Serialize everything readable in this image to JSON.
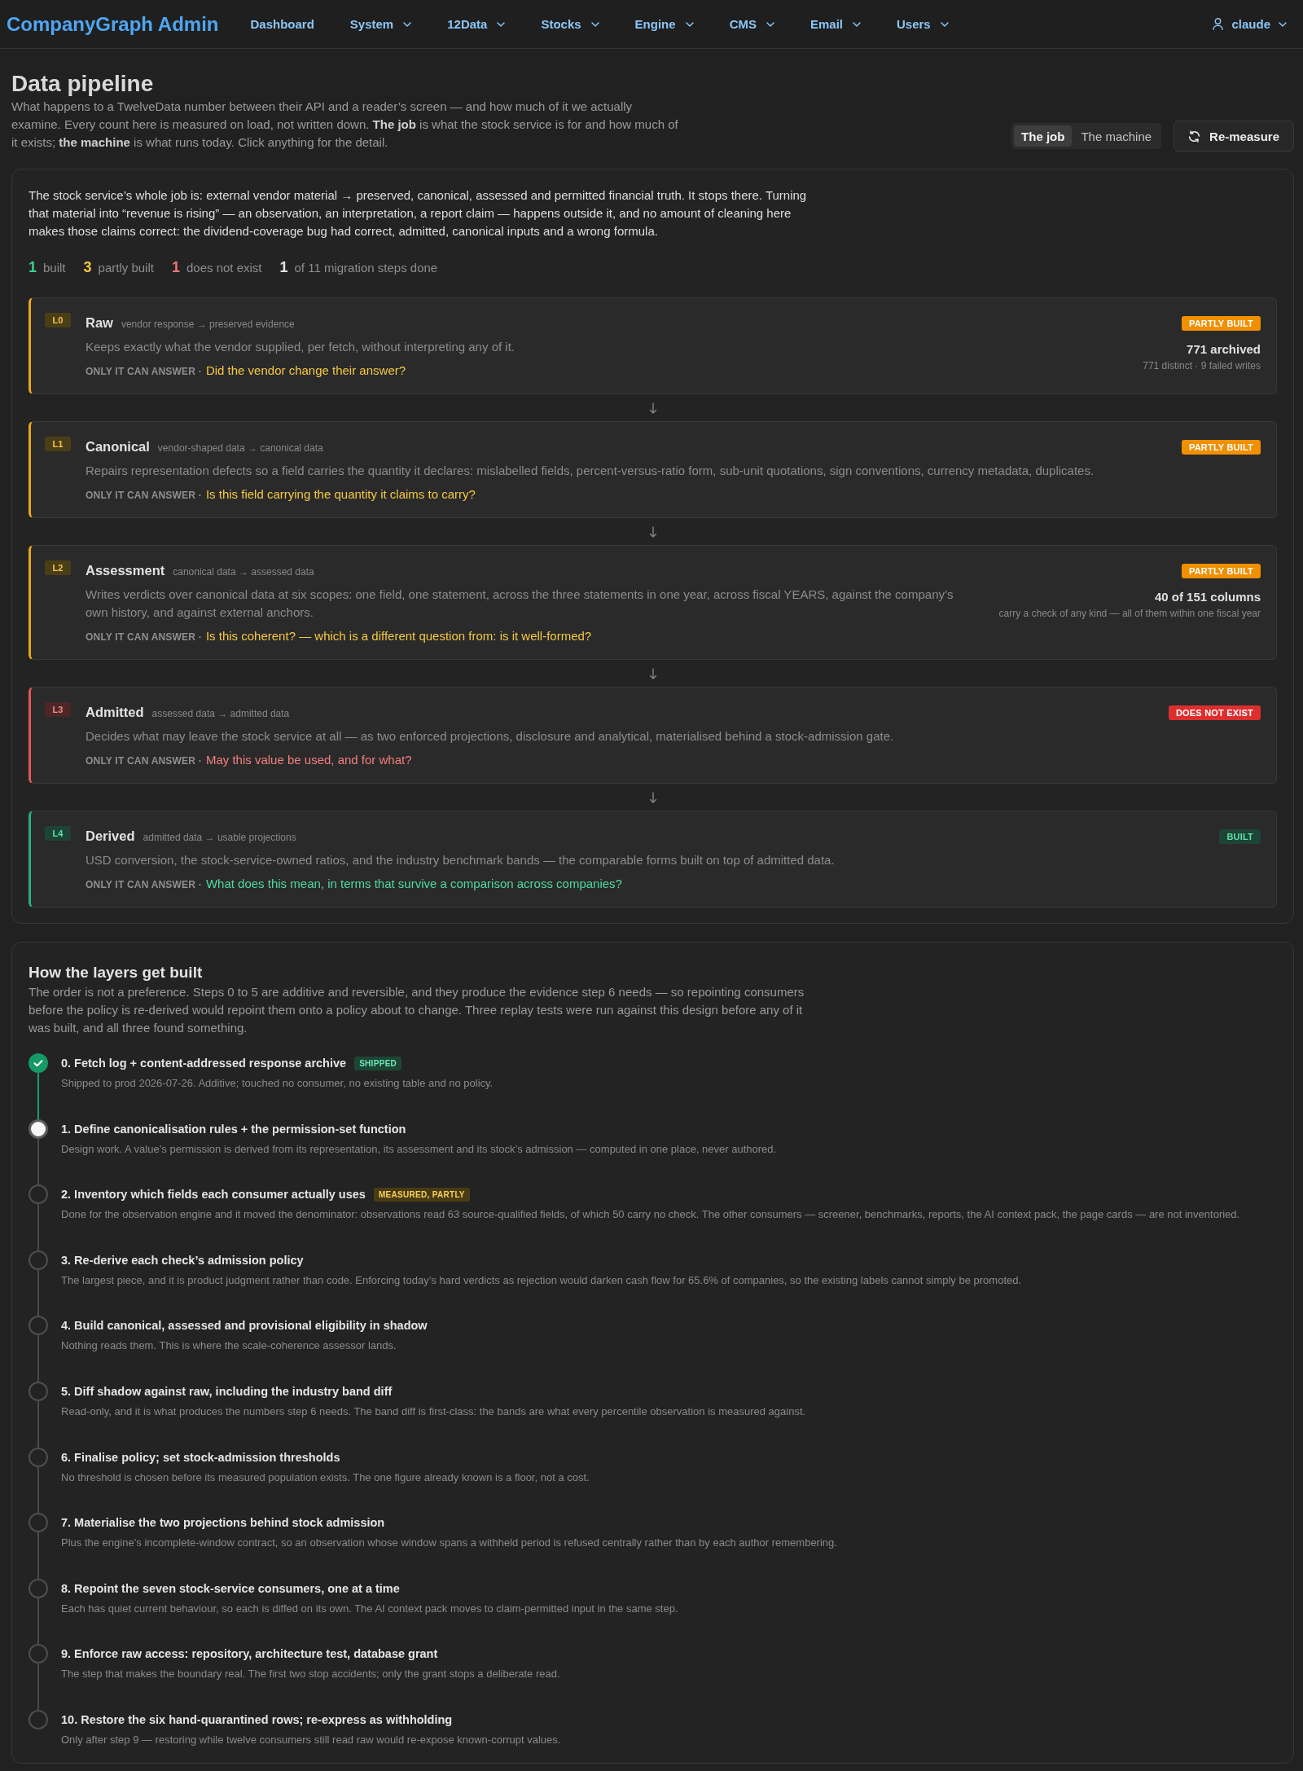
{
  "nav": {
    "brand": "CompanyGraph Admin",
    "items": [
      {
        "label": "Dashboard",
        "dropdown": false
      },
      {
        "label": "System",
        "dropdown": true
      },
      {
        "label": "12Data",
        "dropdown": true
      },
      {
        "label": "Stocks",
        "dropdown": true
      },
      {
        "label": "Engine",
        "dropdown": true
      },
      {
        "label": "CMS",
        "dropdown": true
      },
      {
        "label": "Email",
        "dropdown": true
      },
      {
        "label": "Users",
        "dropdown": true
      }
    ],
    "user": {
      "name": "claude",
      "dropdown": true
    }
  },
  "header": {
    "title": "Data pipeline",
    "description": "What happens to a TwelveData number between their API and a reader’s screen — and how much of it we actually examine. Every count here is measured on load, not written down. **The job** is what the stock service is for and how much of it exists; **the machine** is what runs today. Click anything for the detail.",
    "view_tabs": [
      {
        "label": "The job",
        "selected": true
      },
      {
        "label": "The machine",
        "selected": false
      }
    ],
    "remeasure_button": "Re-measure"
  },
  "job": {
    "intro": "The stock service’s whole job is: external vendor material → preserved, canonical, assessed and permitted financial truth. It stops there. Turning that material into “revenue is rising” — an observation, an interpretation, a report claim — happens outside it, and no amount of cleaning here makes those claims correct: the dividend-coverage bug had correct, admitted, canonical inputs and a wrong formula.",
    "counts": [
      {
        "figure": "1",
        "caption": "built",
        "color": "#3ecf8e"
      },
      {
        "figure": "3",
        "caption": "partly built",
        "color": "#f5c542"
      },
      {
        "figure": "1",
        "caption": "does not exist",
        "color": "#f07575"
      },
      {
        "figure": "1",
        "caption": "of 11 migration steps done",
        "color": "#e2e2e2"
      }
    ],
    "layers": [
      {
        "code": "L0",
        "name": "Raw",
        "flow": "vendor response → preserved evidence",
        "description": "Keeps exactly what the vendor supplied, per fetch, without interpreting any of it.",
        "answer_label": "ONLY IT CAN ANSWER ·",
        "question": "Did the vendor change their answer?",
        "kind": "partial",
        "status_label": "PARTLY BUILT",
        "metric": {
          "value": "771 archived",
          "detail": "771 distinct · 9 failed writes"
        }
      },
      {
        "code": "L1",
        "name": "Canonical",
        "flow": "vendor-shaped data → canonical data",
        "description": "Repairs representation defects so a field carries the quantity it declares: mislabelled fields, percent-versus-ratio form, sub-unit quotations, sign conventions, currency metadata, duplicates.",
        "answer_label": "ONLY IT CAN ANSWER ·",
        "question": "Is this field carrying the quantity it claims to carry?",
        "kind": "partial",
        "status_label": "PARTLY BUILT"
      },
      {
        "code": "L2",
        "name": "Assessment",
        "flow": "canonical data → assessed data",
        "description": "Writes verdicts over canonical data at six scopes: one field, one statement, across the three statements in one year, across fiscal YEARS, against the company’s own history, and against external anchors.",
        "answer_label": "ONLY IT CAN ANSWER ·",
        "question": "Is this coherent? — which is a different question from: is it well-formed?",
        "kind": "partial",
        "status_label": "PARTLY BUILT",
        "metric": {
          "value": "40 of 151 columns",
          "detail": "carry a check of any kind — all of them within one fiscal year"
        }
      },
      {
        "code": "L3",
        "name": "Admitted",
        "flow": "assessed data → admitted data",
        "description": "Decides what may leave the stock service at all — as two enforced projections, disclosure and analytical, materialised behind a stock-admission gate.",
        "answer_label": "ONLY IT CAN ANSWER ·",
        "question": "May this value be used, and for what?",
        "kind": "missing",
        "status_label": "DOES NOT EXIST"
      },
      {
        "code": "L4",
        "name": "Derived",
        "flow": "admitted data → usable projections",
        "description": "USD conversion, the stock-service-owned ratios, and the industry benchmark bands — the comparable forms built on top of admitted data.",
        "answer_label": "ONLY IT CAN ANSWER ·",
        "question": "What does this mean, in terms that survive a comparison across companies?",
        "kind": "built",
        "status_label": "BUILT"
      }
    ]
  },
  "build": {
    "title": "How the layers get built",
    "description": "The order is not a preference. Steps 0 to 5 are additive and reversible, and they produce the evidence step 6 needs — so repointing consumers before the policy is re-derived would repoint them onto a policy about to change. Three replay tests were run against this design before any of it was built, and all three found something.",
    "steps": [
      {
        "title": "0. Fetch log + content-addressed response archive",
        "tag": {
          "label": "SHIPPED",
          "kind": "shipped"
        },
        "description": "Shipped to prod 2026-07-26. Additive; touched no consumer, no existing table and no policy.",
        "kind": "done"
      },
      {
        "title": "1. Define canonicalisation rules + the permission-set function",
        "description": "Design work. A value’s permission is derived from its representation, its assessment and its stock’s admission — computed in one place, never authored.",
        "kind": "current"
      },
      {
        "title": "2. Inventory which fields each consumer actually uses",
        "tag": {
          "label": "MEASURED, PARTLY",
          "kind": "partial"
        },
        "description": "Done for the observation engine and it moved the denominator: observations read 63 source-qualified fields, of which 50 carry no check. The other consumers — screener, benchmarks, reports, the AI context pack, the page cards — are not inventoried.",
        "kind": "pending"
      },
      {
        "title": "3. Re-derive each check’s admission policy",
        "description": "The largest piece, and it is product judgment rather than code. Enforcing today’s hard verdicts as rejection would darken cash flow for 65.6% of companies, so the existing labels cannot simply be promoted.",
        "kind": "pending"
      },
      {
        "title": "4. Build canonical, assessed and provisional eligibility in shadow",
        "description": "Nothing reads them. This is where the scale-coherence assessor lands.",
        "kind": "pending"
      },
      {
        "title": "5. Diff shadow against raw, including the industry band diff",
        "description": "Read-only, and it is what produces the numbers step 6 needs. The band diff is first-class: the bands are what every percentile observation is measured against.",
        "kind": "pending"
      },
      {
        "title": "6. Finalise policy; set stock-admission thresholds",
        "description": "No threshold is chosen before its measured population exists. The one figure already known is a floor, not a cost.",
        "kind": "pending"
      },
      {
        "title": "7. Materialise the two projections behind stock admission",
        "description": "Plus the engine’s incomplete-window contract, so an observation whose window spans a withheld period is refused centrally rather than by each author remembering.",
        "kind": "pending"
      },
      {
        "title": "8. Repoint the seven stock-service consumers, one at a time",
        "description": "Each has quiet current behaviour, so each is diffed on its own. The AI context pack moves to claim-permitted input in the same step.",
        "kind": "pending"
      },
      {
        "title": "9. Enforce raw access: repository, architecture test, database grant",
        "description": "The step that makes the boundary real. The first two stop accidents; only the grant stops a deliberate read.",
        "kind": "pending"
      },
      {
        "title": "10. Restore the six hand-quarantined rows; re-express as withholding",
        "description": "Only after step 9 — restoring while twelve consumers still read raw would re-expose known-corrupt values.",
        "kind": "pending"
      }
    ]
  }
}
